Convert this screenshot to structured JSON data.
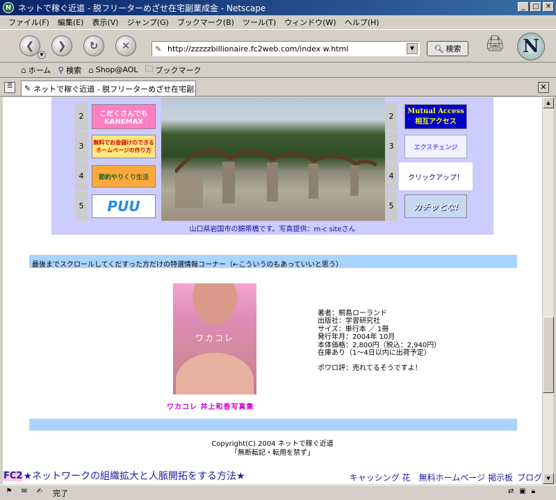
{
  "window": {
    "title": "ネットで稼ぐ近道 - 脱フリーターめざせ在宅副業成金 - Netscape",
    "app_icon": "N",
    "controls": [
      "_",
      "□",
      "✕"
    ]
  },
  "menu": [
    "ファイル(F)",
    "編集(E)",
    "表示(V)",
    "ジャンプ(G)",
    "ブックマーク(B)",
    "ツール(T)",
    "ウィンドウ(W)",
    "ヘルプ(H)"
  ],
  "nav": {
    "url": "http://zzzzzbillionaire.fc2web.com/index w.html",
    "search_label": "検索",
    "logo_letter": "N"
  },
  "personal_toolbar": {
    "items": [
      "ホーム",
      "検索",
      "Shop@AOL",
      "ブックマーク"
    ]
  },
  "tab": {
    "label": "ネットで稼ぐ近道 - 脱フリーターめざせ在宅副..."
  },
  "content": {
    "left_banners": [
      {
        "rank": "2",
        "text": "こだくさんでも\nKANEMAX",
        "bg": "#ff7fbf",
        "fg": "#ffffff"
      },
      {
        "rank": "3",
        "text": "無料でお金儲けのできる\nホームページの作り方",
        "bg": "#ffe97f",
        "fg": "#e00000"
      },
      {
        "rank": "4",
        "text": "節約やりくり生活",
        "bg": "#ffa83c",
        "fg": "#226622"
      },
      {
        "rank": "5",
        "text": "PUU",
        "bg": "#ffffff",
        "fg": "#2a8ae0"
      }
    ],
    "right_banners": [
      {
        "rank": "2",
        "text": "Mutual Access\n相互アクセス",
        "bg": "#0000c8",
        "fg": "#ffff00"
      },
      {
        "rank": "3",
        "text": "エクスチェンジ",
        "bg": "#f0f0ff",
        "fg": "#6060ff"
      },
      {
        "rank": "4",
        "text": "クリックアップ！",
        "bg": "#ffffff",
        "fg": "#000080"
      },
      {
        "rank": "5",
        "text": "カチッとな!",
        "bg": "#c8d8f0",
        "fg": "#ffffff"
      }
    ],
    "photo_caption": "山口県岩国市の錦帯橋です。写真提供：m-c siteさん",
    "special_label": "最後までスクロールしてくだすった方だけの特選情報コーナー（←こういうのもあっていいと思う）",
    "book": {
      "cover_title": "ワカコレ",
      "title": "ワカコレ 井上和香写真集",
      "info": [
        "著者：桐島ローランド",
        "出版社：学習研究社",
        "サイズ：単行本 ／ 1冊",
        "発行年月：2004年 10月",
        "本体価格：2,800円（税込：2,940円）",
        "在庫あり（1～4日以内に出荷予定）",
        "",
        "ポワロ評：売れてるそうですよ！"
      ]
    },
    "copyright": [
      "Copyright(C) 2004 ネットで稼ぐ近道",
      "「無断転記・転用を禁ず」"
    ],
    "footer": {
      "fc2": "FC2",
      "headline": "★ネットワークの組織拡大と人脈開拓をする方法★",
      "links": [
        "キャッシング 花",
        "無料ホームページ",
        "掲示板",
        "ブログ"
      ]
    }
  },
  "status": {
    "text": "完了"
  }
}
